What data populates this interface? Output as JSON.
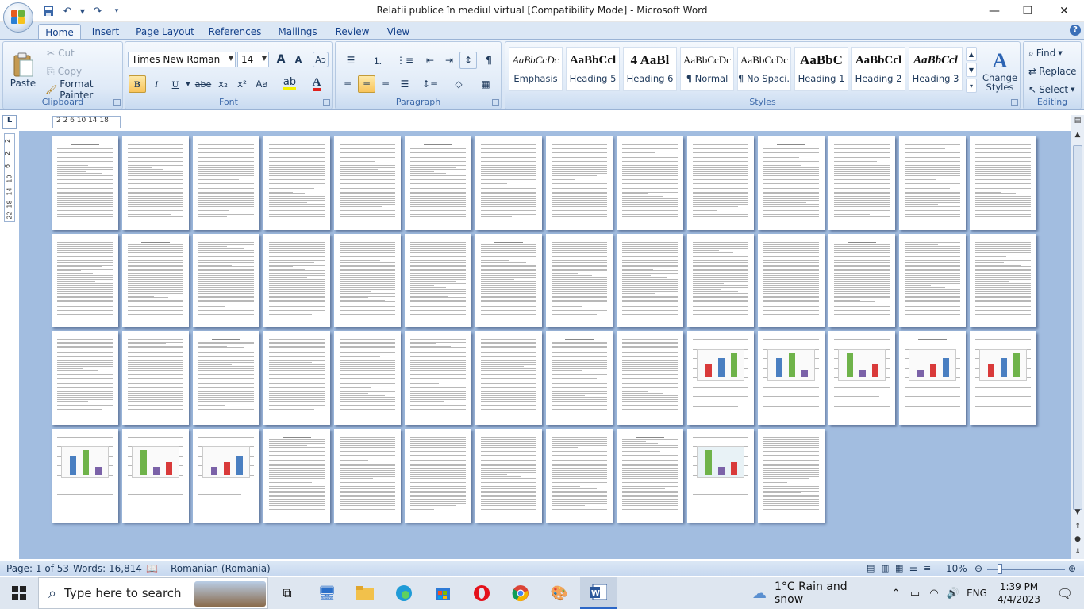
{
  "window": {
    "title": "Relatii publice în mediul virtual [Compatibility Mode] - Microsoft Word",
    "minimize_glyph": "—",
    "restore_glyph": "❐",
    "close_glyph": "✕"
  },
  "ribbon": {
    "tabs": [
      "Home",
      "Insert",
      "Page Layout",
      "References",
      "Mailings",
      "Review",
      "View"
    ],
    "active_tab": "Home",
    "clipboard": {
      "paste": "Paste",
      "cut": "Cut",
      "copy": "Copy",
      "format_painter": "Format Painter",
      "label": "Clipboard"
    },
    "font": {
      "family": "Times New Roman",
      "size": "14",
      "grow": "A",
      "shrink": "A",
      "bold": "B",
      "italic": "I",
      "underline": "U",
      "strike": "abe",
      "subscript": "x₂",
      "superscript": "x²",
      "change_case": "Aa",
      "label": "Font"
    },
    "paragraph": {
      "label": "Paragraph"
    },
    "styles": {
      "items": [
        {
          "preview": "AaBbCcDc",
          "name": "Emphasis"
        },
        {
          "preview": "AaBbCcl",
          "name": "Heading 5"
        },
        {
          "preview": "4  AaBl",
          "name": "Heading 6"
        },
        {
          "preview": "AaBbCcDc",
          "name": "¶ Normal"
        },
        {
          "preview": "AaBbCcDc",
          "name": "¶ No Spaci..."
        },
        {
          "preview": "AaBbC",
          "name": "Heading 1"
        },
        {
          "preview": "AaBbCcl",
          "name": "Heading 2"
        },
        {
          "preview": "AaBbCcl",
          "name": "Heading 3"
        }
      ],
      "change_styles": "Change Styles",
      "label": "Styles"
    },
    "editing": {
      "find": "Find",
      "replace": "Replace",
      "select": "Select",
      "label": "Editing"
    }
  },
  "ruler": {
    "corner": "L",
    "horizontal_ticks": "2  2  6  10  14  18",
    "vertical_ticks": [
      "2",
      "2",
      "6",
      "10",
      "14",
      "18",
      "22"
    ]
  },
  "document": {
    "page_count_shown": 53
  },
  "status": {
    "page": "Page: 1 of 53",
    "words": "Words: 16,814",
    "language": "Romanian (Romania)",
    "zoom": "10%",
    "zoom_level_fraction": 0.1
  },
  "taskbar": {
    "search_placeholder": "Type here to search",
    "weather": "1°C  Rain and snow",
    "input_lang": "ENG",
    "time": "1:39 PM",
    "date": "4/4/2023"
  },
  "colors": {
    "doc_background": "#a2bde0",
    "ribbon_accent": "#15428b",
    "selected_button": "#f9c45b"
  }
}
